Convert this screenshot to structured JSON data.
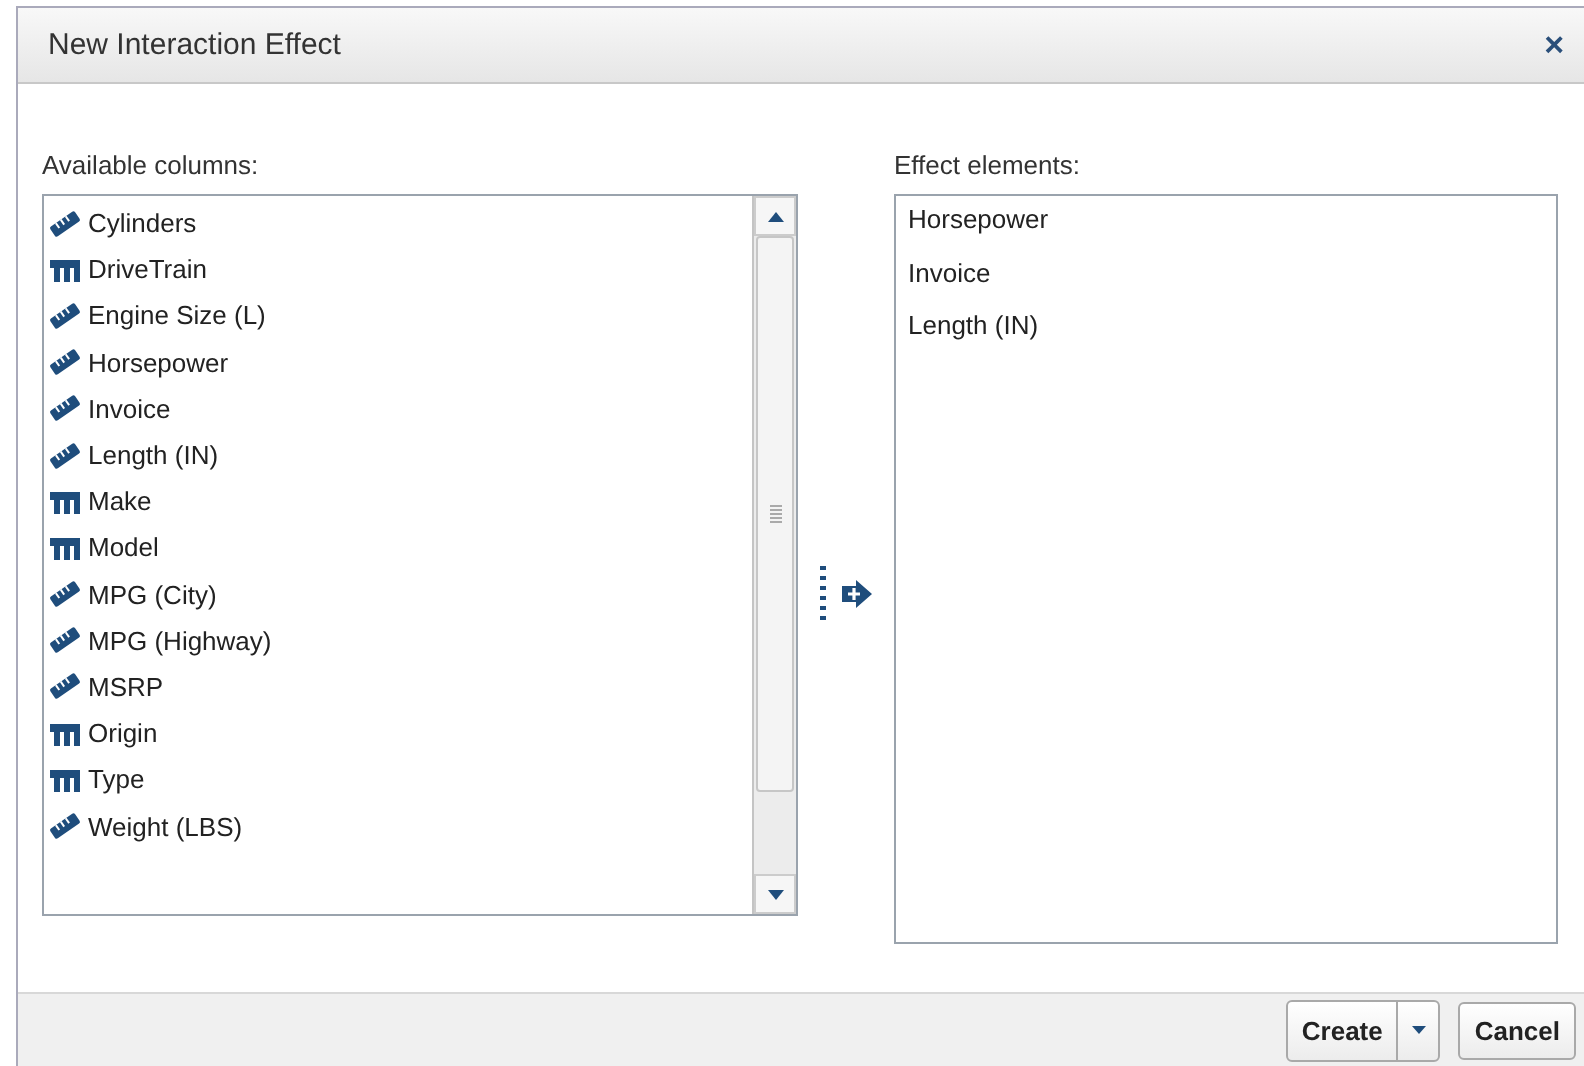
{
  "window": {
    "title": "New Interaction Effect",
    "close": "×"
  },
  "available": {
    "label": "Available columns:",
    "items": [
      {
        "name": "Cylinders",
        "kind": "measure"
      },
      {
        "name": "DriveTrain",
        "kind": "category"
      },
      {
        "name": "Engine Size (L)",
        "kind": "measure"
      },
      {
        "name": "Horsepower",
        "kind": "measure"
      },
      {
        "name": "Invoice",
        "kind": "measure"
      },
      {
        "name": "Length (IN)",
        "kind": "measure"
      },
      {
        "name": "Make",
        "kind": "category"
      },
      {
        "name": "Model",
        "kind": "category"
      },
      {
        "name": "MPG (City)",
        "kind": "measure"
      },
      {
        "name": "MPG (Highway)",
        "kind": "measure"
      },
      {
        "name": "MSRP",
        "kind": "measure"
      },
      {
        "name": "Origin",
        "kind": "category"
      },
      {
        "name": "Type",
        "kind": "category"
      },
      {
        "name": "Weight (LBS)",
        "kind": "measure"
      }
    ]
  },
  "effect": {
    "label": "Effect elements:",
    "items": [
      "Horsepower",
      "Invoice",
      "Length (IN)"
    ]
  },
  "buttons": {
    "create": "Create",
    "cancel": "Cancel"
  }
}
